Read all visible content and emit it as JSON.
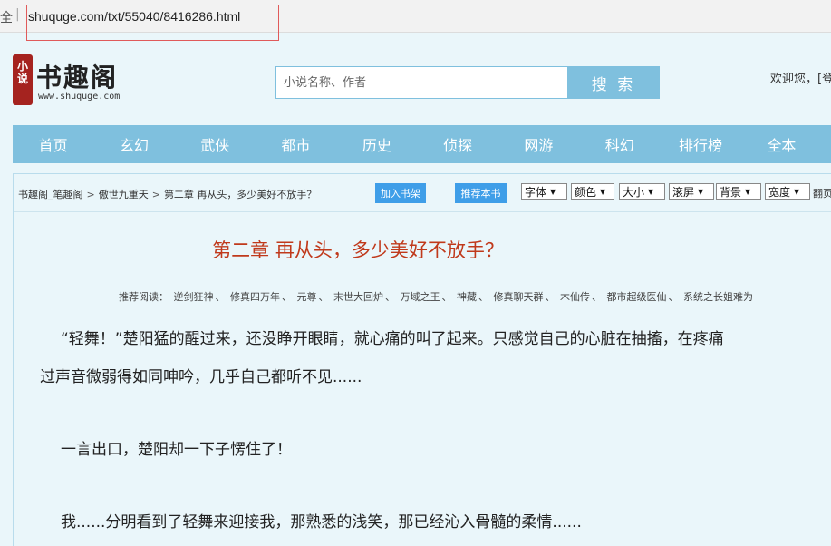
{
  "browser": {
    "url_prefix": "全",
    "url_separator": "|",
    "url": "shuquge.com/txt/55040/8416286.html"
  },
  "header": {
    "logo_seal": "小说",
    "logo_text": "书趣阁",
    "logo_domain": "www.shuquge.com",
    "search_placeholder": "小说名称、作者",
    "search_button": "搜 索",
    "welcome": "欢迎您，[登"
  },
  "nav": {
    "items": [
      "首页",
      "玄幻",
      "武侠",
      "都市",
      "历史",
      "侦探",
      "网游",
      "科幻",
      "排行榜",
      "全本"
    ]
  },
  "toolbar": {
    "breadcrumb": [
      "书趣阁_笔趣阁",
      "傲世九重天",
      "第二章 再从头，多少美好不放手？"
    ],
    "breadcrumb_sep": ">",
    "add_shelf": "加入书架",
    "recommend_book": "推荐本书",
    "selects": [
      "字体",
      "颜色",
      "大小",
      "滚屏",
      "背景",
      "宽度"
    ],
    "more": "翻页"
  },
  "chapter": {
    "title": "第二章 再从头，多少美好不放手？",
    "recommend_label": "推荐阅读：",
    "recommend_items": [
      "逆剑狂神",
      "修真四万年",
      "元尊",
      "末世大回炉",
      "万域之王",
      "神藏",
      "修真聊天群",
      "木仙传",
      "都市超级医仙",
      "系统之长姐难为"
    ],
    "recommend_sep": "、",
    "paragraphs": [
      "“轻舞！”楚阳猛的醒过来，还没睁开眼睛，就心痛的叫了起来。只感觉自己的心脏在抽搐，在疼痛",
      "过声音微弱得如同呻吟，几乎自己都听不见......",
      "一言出口，楚阳却一下子愣住了！",
      "我......分明看到了轻舞来迎接我，那熟悉的浅笑，那已经沁入骨髓的柔情......"
    ]
  }
}
